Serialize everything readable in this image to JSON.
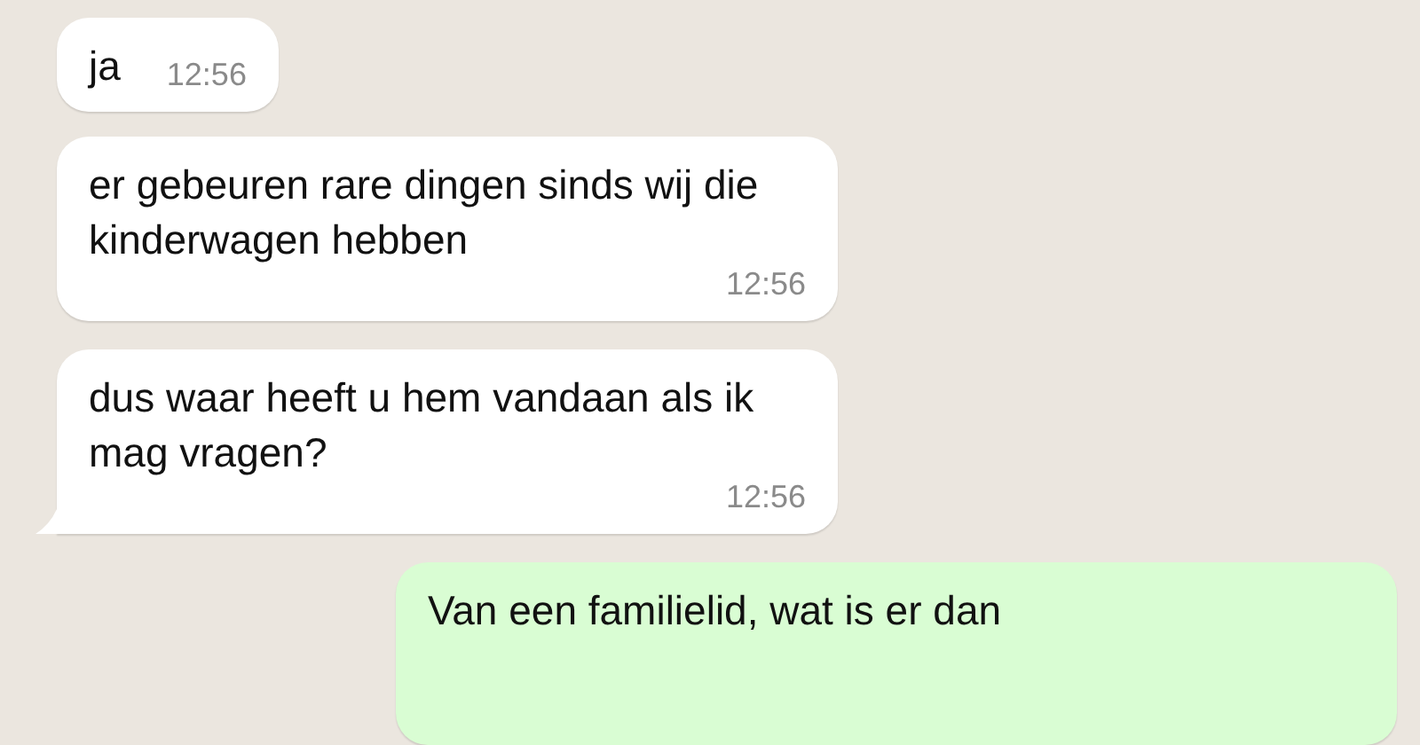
{
  "messages": [
    {
      "kind": "incoming",
      "text": "ja",
      "time": "12:56",
      "tail": false
    },
    {
      "kind": "incoming",
      "text": "er gebeuren rare dingen sinds wij die kinderwagen hebben",
      "time": "12:56",
      "tail": false
    },
    {
      "kind": "incoming",
      "text": "dus waar heeft u hem vandaan als ik mag vragen?",
      "time": "12:56",
      "tail": true
    },
    {
      "kind": "outgoing",
      "text": "Van een familielid, wat is er dan",
      "tail": false
    }
  ]
}
